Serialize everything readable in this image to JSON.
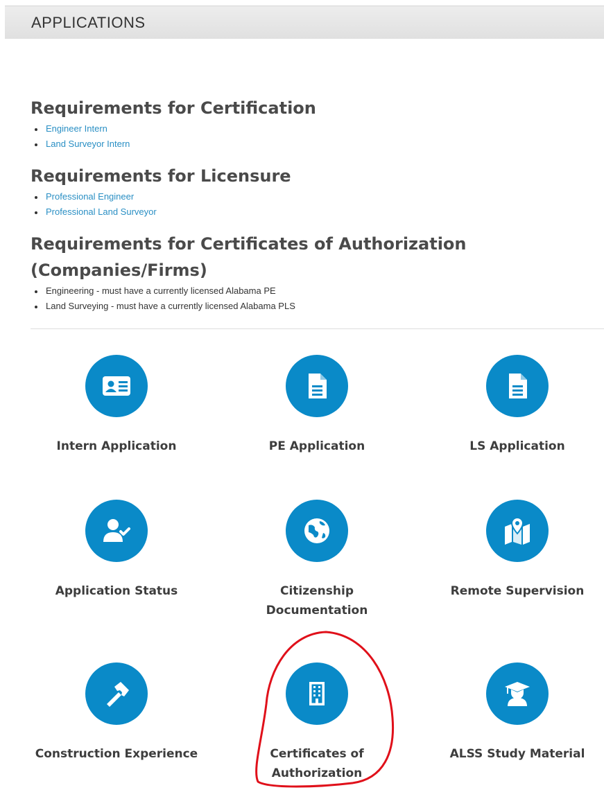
{
  "header": {
    "title": "APPLICATIONS"
  },
  "sections": [
    {
      "heading": "Requirements for Certification",
      "items": [
        "Engineer Intern",
        "Land Surveyor Intern"
      ]
    },
    {
      "heading": "Requirements for Licensure",
      "items": [
        "Professional Engineer",
        "Professional Land Surveyor"
      ]
    },
    {
      "heading_line1": "Requirements for Certificates of Authorization",
      "heading_line2": "(Companies/Firms)",
      "items": [
        "Engineering - must have a currently licensed Alabama PE",
        "Land Surveying - must have a currently licensed Alabama PLS"
      ]
    }
  ],
  "tiles": [
    {
      "label": "Intern Application",
      "icon": "id-card-icon"
    },
    {
      "label": "PE Application",
      "icon": "document-icon"
    },
    {
      "label": "LS Application",
      "icon": "document-icon"
    },
    {
      "label": "Application Status",
      "icon": "user-check-icon"
    },
    {
      "label_line1": "Citizenship",
      "label_line2": "Documentation",
      "icon": "globe-icon"
    },
    {
      "label": "Remote Supervision",
      "icon": "map-marker-icon"
    },
    {
      "label": "Construction Experience",
      "icon": "hammer-icon"
    },
    {
      "label_line1": "Certificates of",
      "label_line2": "Authorization",
      "icon": "building-icon"
    },
    {
      "label": "ALSS Study Material",
      "icon": "graduate-icon"
    }
  ],
  "colors": {
    "accent": "#0a8ac8",
    "link": "#2a8fc4",
    "annotation": "#e0101a"
  }
}
